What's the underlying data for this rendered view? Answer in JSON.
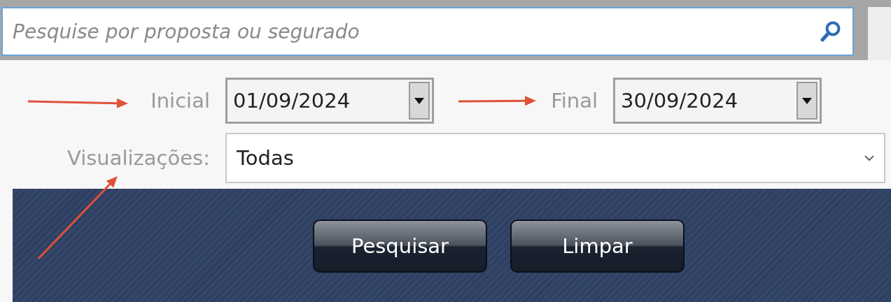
{
  "search": {
    "placeholder": "Pesquise por proposta ou segurado"
  },
  "date_range": [
    {
      "label": "Inicial",
      "value": "01/09/2024"
    },
    {
      "label": "Final",
      "value": "30/09/2024"
    }
  ],
  "view": {
    "label": "Visualizações:",
    "value": "Todas"
  },
  "buttons": [
    "Pesquisar",
    "Limpar"
  ]
}
